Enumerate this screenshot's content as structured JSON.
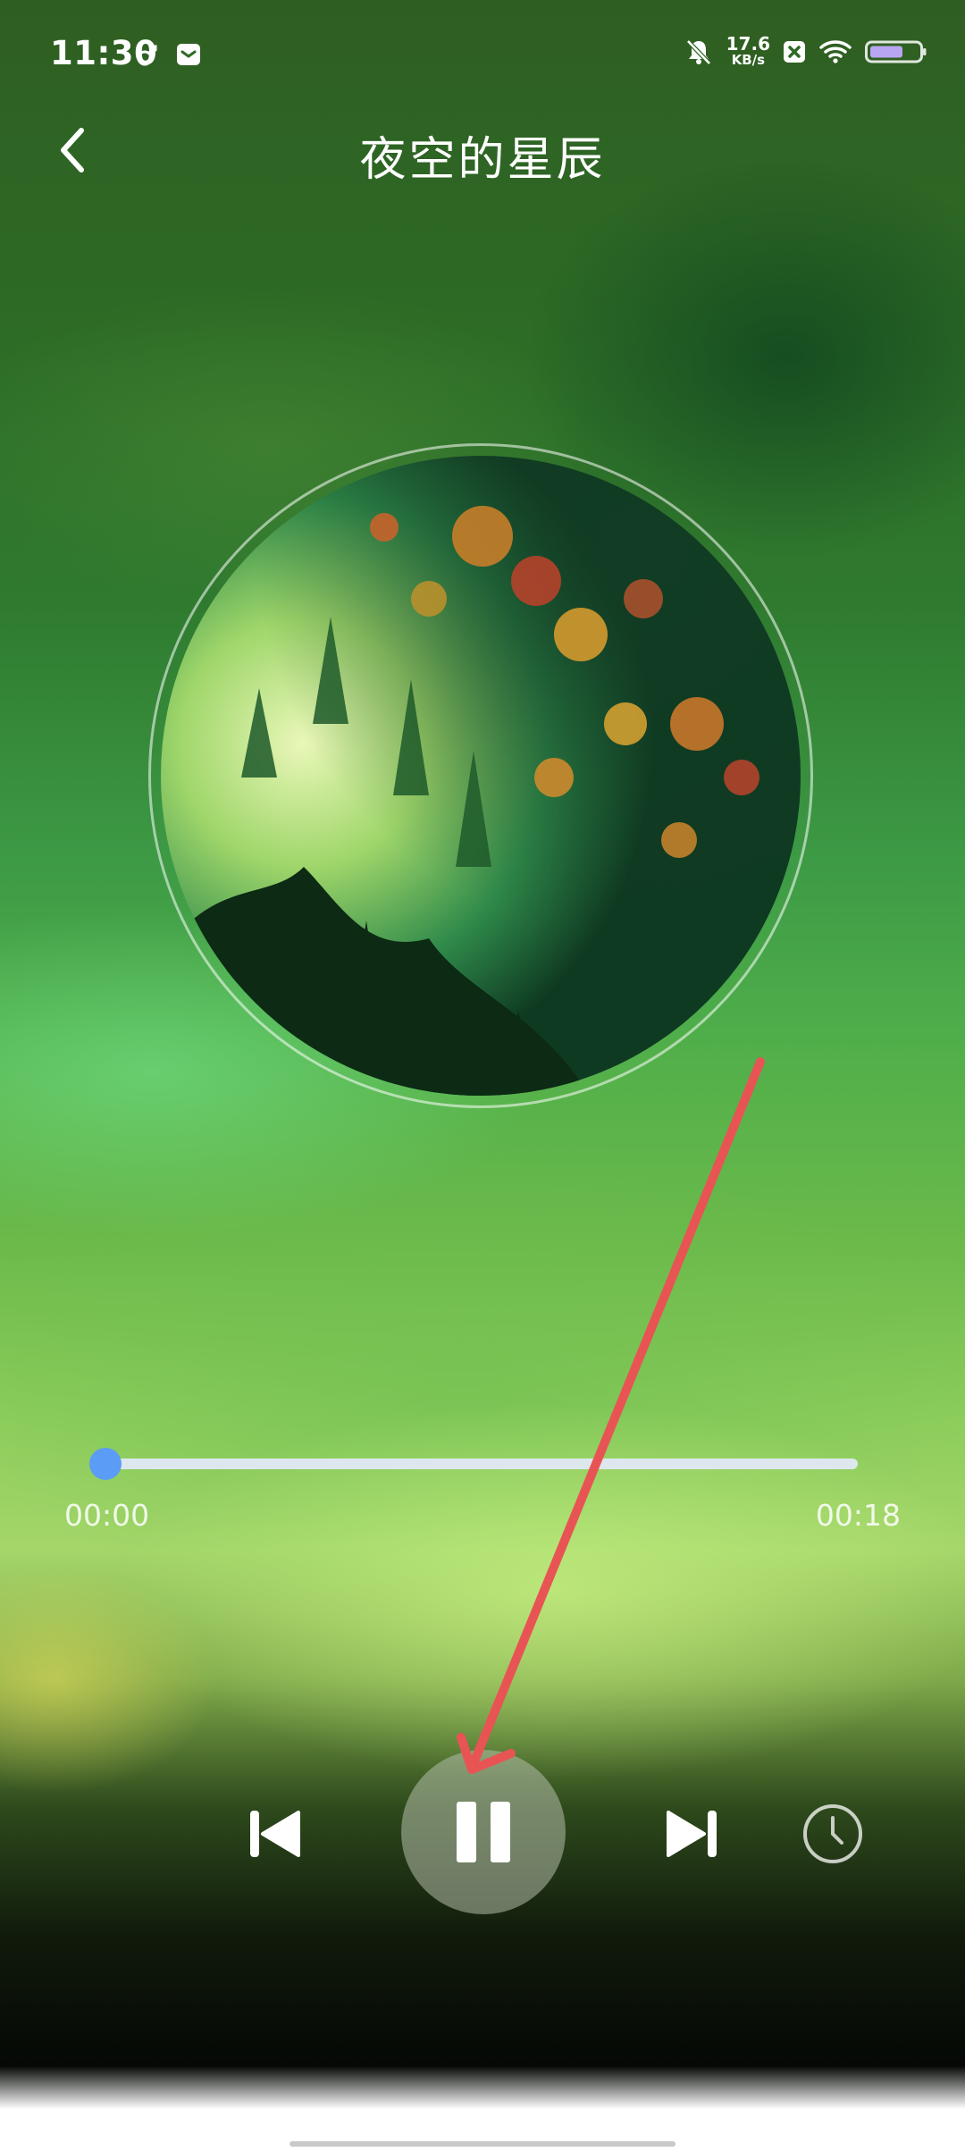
{
  "status_bar": {
    "time": "11:30",
    "net_speed_value": "17.6",
    "net_speed_unit": "KB/s",
    "icons": [
      "link-icon",
      "message-icon",
      "bell-off-icon",
      "x-box-icon",
      "wifi-icon",
      "battery-icon"
    ]
  },
  "header": {
    "back_icon": "back-chevron-icon",
    "title": "夜空的星辰"
  },
  "player": {
    "progress": 0.0,
    "current_time": "00:00",
    "total_time": "00:18",
    "state": "playing",
    "controls": [
      "previous-icon",
      "pause-icon",
      "next-icon",
      "timer-icon"
    ]
  },
  "colors": {
    "accent": "#5b9cf6",
    "annotation": "#e85454"
  }
}
